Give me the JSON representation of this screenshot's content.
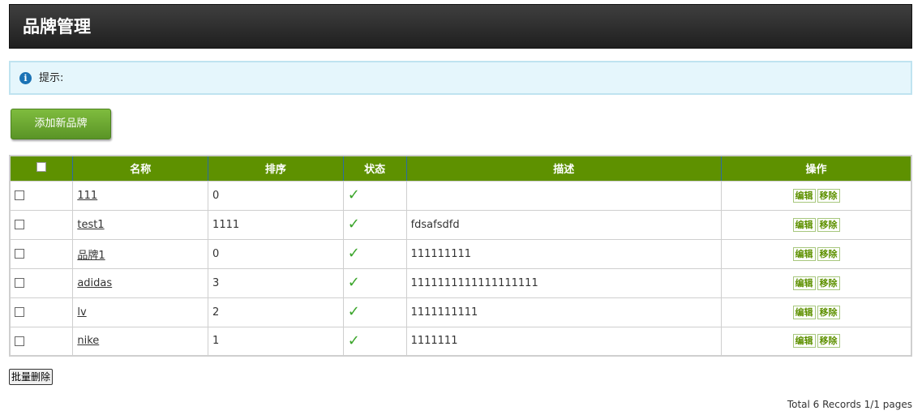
{
  "header": {
    "title": "品牌管理"
  },
  "notice": {
    "text": "提示:"
  },
  "toolbar": {
    "add_label": "添加新品牌"
  },
  "table": {
    "columns": [
      "名称",
      "排序",
      "状态",
      "描述",
      "操作"
    ],
    "rows": [
      {
        "name": "111",
        "sort": "0",
        "desc": ""
      },
      {
        "name": "test1",
        "sort": "1111",
        "desc": "fdsafsdfd"
      },
      {
        "name": "品牌1",
        "sort": "0",
        "desc": "111111111"
      },
      {
        "name": "adidas",
        "sort": "3",
        "desc": "1111111111111111111"
      },
      {
        "name": "lv",
        "sort": "2",
        "desc": "1111111111"
      },
      {
        "name": "nike",
        "sort": "1",
        "desc": "1111111"
      }
    ],
    "edit_label": "编辑",
    "remove_label": "移除"
  },
  "footer": {
    "batch_delete_label": "批量删除",
    "pager_text": "Total 6 Records 1/1 pages"
  },
  "colors": {
    "header_bg": "#2d2d2d",
    "table_header": "#5e9100",
    "accent_green": "#3aa52a",
    "notice_bg": "#e5f6fc"
  }
}
